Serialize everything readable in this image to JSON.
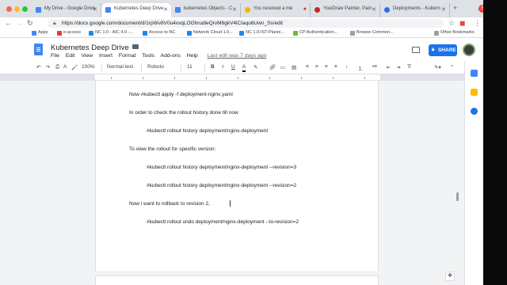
{
  "browser": {
    "tabs": [
      {
        "title": "My Drive - Google Drive",
        "favicon_color": "#4285f4"
      },
      {
        "title": "Kubernetes Deep Drive",
        "favicon_color": "#4285f4",
        "active": true
      },
      {
        "title": "kubernetes Objects - C",
        "favicon_color": "#4285f4"
      },
      {
        "title": "You received a me",
        "favicon_color": "#f4b400"
      },
      {
        "title": "YouiDraw Painter, Pain",
        "favicon_color": "#c62828"
      },
      {
        "title": "Deployments - Kubern",
        "favicon_color": "#326ce5"
      }
    ],
    "profile_initial": "S",
    "url": "https://docs.google.com/document/d/1rpWv8V0u4xvqLOGhrudleQrvM6gkV4lCIaqu6Uwn_Ss/edit",
    "bookmarks": [
      {
        "label": "Apps",
        "color": "#4285f4"
      },
      {
        "label": "e-access",
        "color": "#e53935"
      },
      {
        "label": "NC 1.0 - AIC 4.0 -...",
        "color": "#1e88e5"
      },
      {
        "label": "Access to NC",
        "color": "#1e88e5"
      },
      {
        "label": "Network Cloud 1.0...",
        "color": "#1e88e5"
      },
      {
        "label": "NC 1.0-IST-Planni...",
        "color": "#1e88e5"
      },
      {
        "label": "CP Authentication...",
        "color": "#7cb342"
      },
      {
        "label": "Browse Common...",
        "color": "#9e9e9e"
      },
      {
        "label": "Other Bookmarks",
        "color": "#9e9e9e"
      }
    ]
  },
  "docs": {
    "title": "Kubernetes Deep Drive",
    "menu": [
      "File",
      "Edit",
      "View",
      "Insert",
      "Format",
      "Tools",
      "Add-ons",
      "Help"
    ],
    "last_edit": "Last edit was 7 days ago",
    "share_label": "SHARE",
    "toolbar": {
      "zoom": "100%",
      "style": "Normal text",
      "font": "Roboto",
      "size": "11"
    },
    "lines": [
      "Now      #kubectl apply -f deployment-nginx.yaml",
      "In order to check the rollout history done till now",
      "#kubectl rollout history deployment/nginx-deployment",
      "To view the rollout for specific version:",
      "#kubectl rollout history deployment/nginx-deployment --revision=3",
      "#kubectl rollout history deployment/nginx-deployment --revision=2",
      "Now i want to rollback to revision 2,",
      "#kubectl rollout undo deployment/nginx-deployment --to-revision=2"
    ]
  },
  "colors": {
    "accent": "#1a73e8",
    "docs_blue": "#4285f4"
  }
}
